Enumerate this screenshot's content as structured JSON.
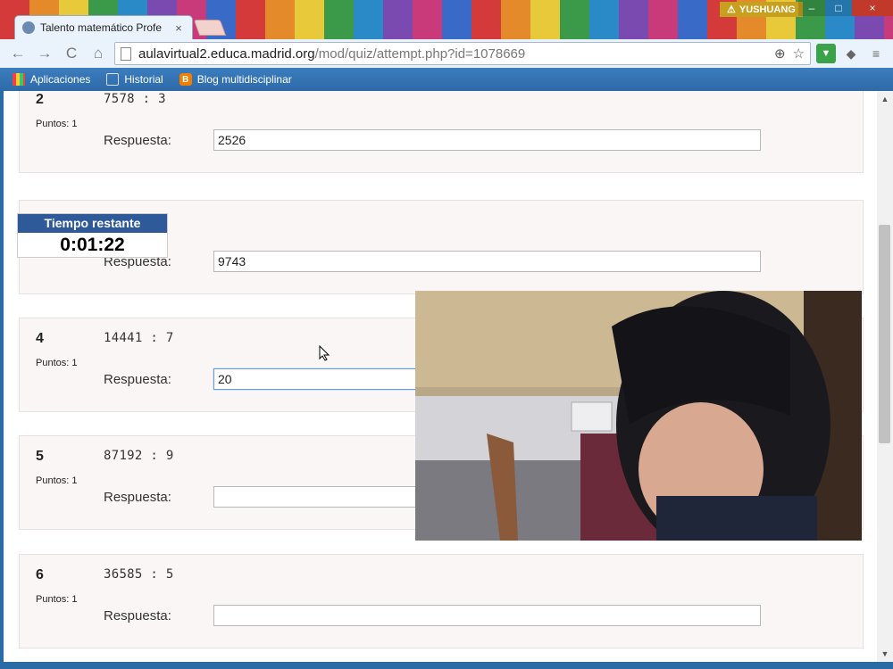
{
  "browser": {
    "tab_title": "Talento matemático Profe",
    "tab_close": "×",
    "user_name": "YUSHUANG",
    "warning_glyph": "⚠",
    "window_minimize": "–",
    "window_maximize": "□",
    "window_close": "×",
    "url_host": "aulavirtual2.educa.madrid.org",
    "url_path": "/mod/quiz/attempt.php?id=1078669",
    "back_glyph": "←",
    "forward_glyph": "→",
    "reload_glyph": "C",
    "home_glyph": "⌂",
    "zoom_glyph": "⊕",
    "star_glyph": "☆",
    "menu_glyph": "≡"
  },
  "bookmarks": {
    "apps_label": "Aplicaciones",
    "history_label": "Historial",
    "blog_label": "Blog multidisciplinar",
    "blog_glyph": "B"
  },
  "timer": {
    "label": "Tiempo restante",
    "value": "0:01:22"
  },
  "quiz": {
    "points_label": "Puntos: 1",
    "answer_label": "Respuesta:",
    "questions": [
      {
        "number": "2",
        "text": "7578 : 3",
        "answer": "2526"
      },
      {
        "number": "",
        "text": "",
        "answer": "9743"
      },
      {
        "number": "4",
        "text": "14441 : 7",
        "answer": "20"
      },
      {
        "number": "5",
        "text": "87192 : 9",
        "answer": ""
      },
      {
        "number": "6",
        "text": "36585 : 5",
        "answer": ""
      }
    ]
  },
  "colors": {
    "timer_header": "#2e5a9a",
    "bookmark_bar": "#2e6aa8",
    "question_bg": "#faf6f5"
  }
}
